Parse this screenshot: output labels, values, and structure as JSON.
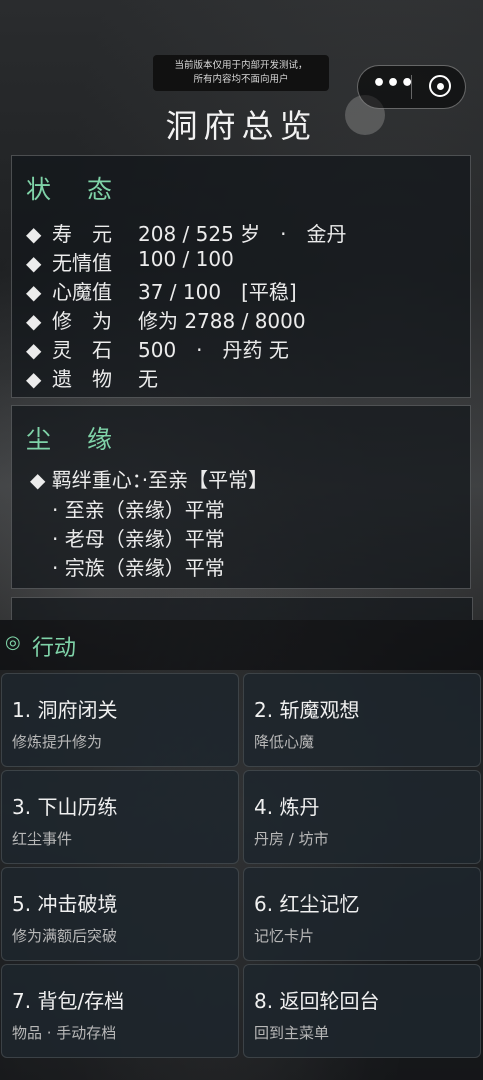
{
  "notice": {
    "line1": "当前版本仅用于内部开发测试，",
    "line2": "所有内容均不面向用户"
  },
  "capsule": {
    "more_icon": "more-dots-icon",
    "close_icon": "target-close-icon"
  },
  "title": "洞府总览",
  "status": {
    "title": "状 态",
    "rows": [
      {
        "label": "寿　元",
        "value": "208 / 525 岁　·　金丹"
      },
      {
        "label": "无情值",
        "value": "100 / 100"
      },
      {
        "label": "心魔值",
        "value": "37 / 100　[平稳]"
      },
      {
        "label": "修　为",
        "value": "修为 2788 / 8000"
      },
      {
        "label": "灵　石",
        "value": "500　·　丹药 无"
      },
      {
        "label": "遗　物",
        "value": "无"
      }
    ]
  },
  "bonds": {
    "title": "尘 缘",
    "main": "◆ 羁绊重心：·至亲【平常】",
    "items": [
      "· 至亲（亲缘）平常",
      "· 老母（亲缘）平常",
      "· 宗族（亲缘）平常"
    ]
  },
  "actions": {
    "header": "行动",
    "cards": [
      {
        "title": "1. 洞府闭关",
        "sub": "修炼提升修为"
      },
      {
        "title": "2. 斩魔观想",
        "sub": "降低心魔"
      },
      {
        "title": "3. 下山历练",
        "sub": "红尘事件"
      },
      {
        "title": "4. 炼丹",
        "sub": "丹房 / 坊市"
      },
      {
        "title": "5. 冲击破境",
        "sub": "修为满额后突破"
      },
      {
        "title": "6. 红尘记忆",
        "sub": "记忆卡片"
      },
      {
        "title": "7. 背包/存档",
        "sub": "物品 · 手动存档"
      },
      {
        "title": "8. 返回轮回台",
        "sub": "回到主菜单"
      }
    ]
  }
}
